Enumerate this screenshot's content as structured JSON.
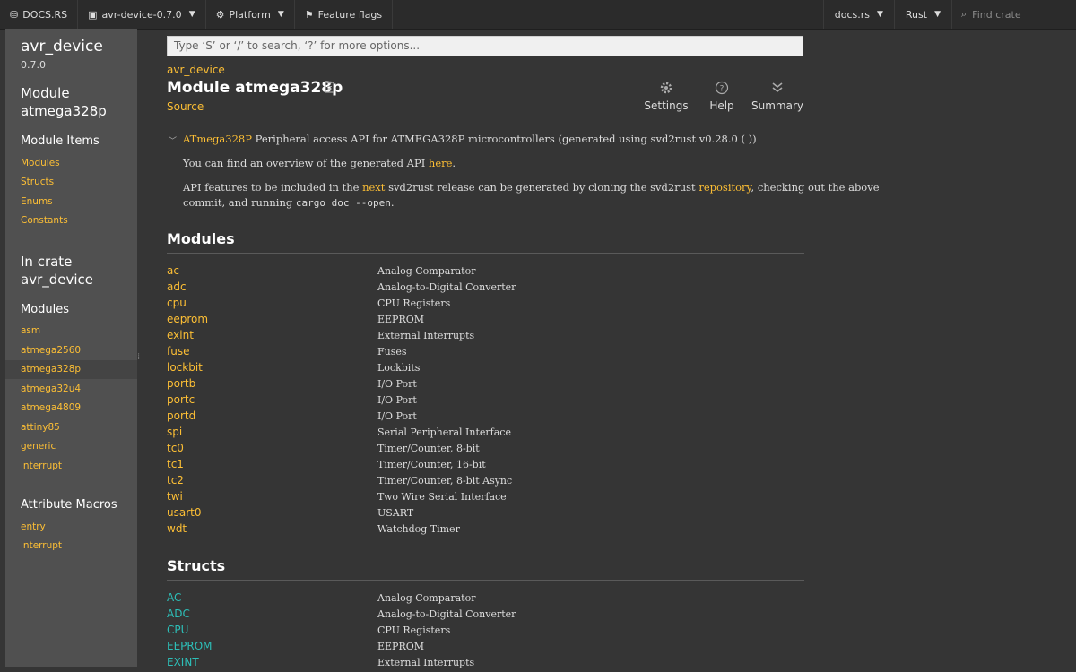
{
  "topnav": {
    "logo_text": "DOCS.RS",
    "crate_label": "avr-device-0.7.0",
    "platform_label": "Platform",
    "feature_flags_label": "Feature flags",
    "docsrs_label": "docs.rs",
    "rust_label": "Rust",
    "search_placeholder": "Find crate"
  },
  "sidebar": {
    "crate_name": "avr_device",
    "version": "0.7.0",
    "module_heading": "Module",
    "module_name": "atmega328p",
    "module_items_heading": "Module Items",
    "module_items": [
      "Modules",
      "Structs",
      "Enums",
      "Constants"
    ],
    "in_crate_heading": "In crate",
    "in_crate_name": "avr_device",
    "modules_heading": "Modules",
    "modules": [
      "asm",
      "atmega2560",
      "atmega328p",
      "atmega32u4",
      "atmega4809",
      "attiny85",
      "generic",
      "interrupt"
    ],
    "current_module": "atmega328p",
    "attr_macros_heading": "Attribute Macros",
    "attr_macros": [
      "entry",
      "interrupt"
    ]
  },
  "main": {
    "search_placeholder": "Type ‘S’ or ‘/’ to search, ‘?’ for more options...",
    "breadcrumb": "avr_device",
    "title": "Module atmega328p",
    "source_label": "Source",
    "tools": {
      "settings": "Settings",
      "help": "Help",
      "summary": "Summary"
    },
    "doc": {
      "line1_link": "ATmega328P",
      "line1_text": " Peripheral access API for ATMEGA328P microcontrollers (generated using svd2rust v0.28.0 ( ))",
      "line2_text": "You can find an overview of the generated API ",
      "line2_link": "here",
      "line2_end": ".",
      "line3_a": "API features to be included in the ",
      "line3_link1": "next",
      "line3_b": " svd2rust release can be generated by cloning the svd2rust ",
      "line3_link2": "repository",
      "line3_c": ", checking out the above",
      "line4_a": "commit, and running ",
      "line4_code": "cargo doc --open",
      "line4_end": "."
    },
    "modules_heading": "Modules",
    "modules": [
      {
        "name": "ac",
        "desc": "Analog Comparator"
      },
      {
        "name": "adc",
        "desc": "Analog-to-Digital Converter"
      },
      {
        "name": "cpu",
        "desc": "CPU Registers"
      },
      {
        "name": "eeprom",
        "desc": "EEPROM"
      },
      {
        "name": "exint",
        "desc": "External Interrupts"
      },
      {
        "name": "fuse",
        "desc": "Fuses"
      },
      {
        "name": "lockbit",
        "desc": "Lockbits"
      },
      {
        "name": "portb",
        "desc": "I/O Port"
      },
      {
        "name": "portc",
        "desc": "I/O Port"
      },
      {
        "name": "portd",
        "desc": "I/O Port"
      },
      {
        "name": "spi",
        "desc": "Serial Peripheral Interface"
      },
      {
        "name": "tc0",
        "desc": "Timer/Counter, 8-bit"
      },
      {
        "name": "tc1",
        "desc": "Timer/Counter, 16-bit"
      },
      {
        "name": "tc2",
        "desc": "Timer/Counter, 8-bit Async"
      },
      {
        "name": "twi",
        "desc": "Two Wire Serial Interface"
      },
      {
        "name": "usart0",
        "desc": "USART"
      },
      {
        "name": "wdt",
        "desc": "Watchdog Timer"
      }
    ],
    "structs_heading": "Structs",
    "structs": [
      {
        "name": "AC",
        "desc": "Analog Comparator"
      },
      {
        "name": "ADC",
        "desc": "Analog-to-Digital Converter"
      },
      {
        "name": "CPU",
        "desc": "CPU Registers"
      },
      {
        "name": "EEPROM",
        "desc": "EEPROM"
      },
      {
        "name": "EXINT",
        "desc": "External Interrupts"
      }
    ]
  },
  "colors": {
    "link": "#fdbf35",
    "struct": "#2dbfb8",
    "background": "#353535",
    "sidebar": "#505050"
  },
  "icons": [
    "cube-icon",
    "package-icon",
    "gear-icon",
    "flag-icon",
    "search-icon",
    "copy-icon",
    "help-icon",
    "summary-icon",
    "chevron-down-icon"
  ]
}
